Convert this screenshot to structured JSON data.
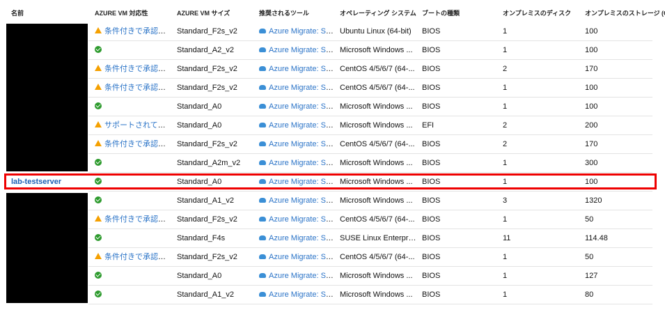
{
  "columns": {
    "name": "名前",
    "compat": "AZURE VM 対応性",
    "size": "AZURE VM サイズ",
    "tool": "推奨されるツール",
    "os": "オペレーティング システム",
    "boot": "ブートの種類",
    "disks": "オンプレミスのディスク",
    "storage": "オンプレミスのストレージ (GB)"
  },
  "colors": {
    "link": "#2a73c7",
    "ok": "#2e9b2e",
    "warning": "#f5a000",
    "highlight": "#ee0000",
    "redaction": "#000000"
  },
  "rows": [
    {
      "name": "",
      "compat_icon": "warning-icon",
      "compat": "条件付きで承認され...",
      "size": "Standard_F2s_v2",
      "tool": "Azure Migrate: Ser...",
      "os": "Ubuntu Linux (64-bit)",
      "boot": "BIOS",
      "disks": "1",
      "storage": "100"
    },
    {
      "name": "",
      "compat_icon": "check-icon",
      "compat": "",
      "size": "Standard_A2_v2",
      "tool": "Azure Migrate: Ser...",
      "os": "Microsoft Windows ...",
      "boot": "BIOS",
      "disks": "1",
      "storage": "100"
    },
    {
      "name": "",
      "compat_icon": "warning-icon",
      "compat": "条件付きで承認され...",
      "size": "Standard_F2s_v2",
      "tool": "Azure Migrate: Ser...",
      "os": "CentOS 4/5/6/7 (64-...",
      "boot": "BIOS",
      "disks": "2",
      "storage": "170"
    },
    {
      "name": "",
      "compat_icon": "warning-icon",
      "compat": "条件付きで承認され...",
      "size": "Standard_F2s_v2",
      "tool": "Azure Migrate: Ser...",
      "os": "CentOS 4/5/6/7 (64-...",
      "boot": "BIOS",
      "disks": "1",
      "storage": "100"
    },
    {
      "name": "",
      "compat_icon": "check-icon",
      "compat": "",
      "size": "Standard_A0",
      "tool": "Azure Migrate: Ser...",
      "os": "Microsoft Windows ...",
      "boot": "BIOS",
      "disks": "1",
      "storage": "100"
    },
    {
      "name": "",
      "compat_icon": "warning-icon",
      "compat": "サポートされていない...",
      "size": "Standard_A0",
      "tool": "Azure Migrate: Ser...",
      "os": "Microsoft Windows ...",
      "boot": "EFI",
      "disks": "2",
      "storage": "200"
    },
    {
      "name": "",
      "compat_icon": "warning-icon",
      "compat": "条件付きで承認され...",
      "size": "Standard_F2s_v2",
      "tool": "Azure Migrate: Ser...",
      "os": "CentOS 4/5/6/7 (64-...",
      "boot": "BIOS",
      "disks": "2",
      "storage": "170"
    },
    {
      "name": "",
      "compat_icon": "check-icon",
      "compat": "",
      "size": "Standard_A2m_v2",
      "tool": "Azure Migrate: Ser...",
      "os": "Microsoft Windows ...",
      "boot": "BIOS",
      "disks": "1",
      "storage": "300"
    },
    {
      "name": "lab-testserver",
      "compat_icon": "check-icon",
      "compat": "",
      "size": "Standard_A0",
      "tool": "Azure Migrate: Ser...",
      "os": "Microsoft Windows ...",
      "boot": "BIOS",
      "disks": "1",
      "storage": "100"
    },
    {
      "name": "",
      "compat_icon": "check-icon",
      "compat": "",
      "size": "Standard_A1_v2",
      "tool": "Azure Migrate: Ser...",
      "os": "Microsoft Windows ...",
      "boot": "BIOS",
      "disks": "3",
      "storage": "1320"
    },
    {
      "name": "",
      "compat_icon": "warning-icon",
      "compat": "条件付きで承認され...",
      "size": "Standard_F2s_v2",
      "tool": "Azure Migrate: Ser...",
      "os": "CentOS 4/5/6/7 (64-...",
      "boot": "BIOS",
      "disks": "1",
      "storage": "50"
    },
    {
      "name": "",
      "compat_icon": "check-icon",
      "compat": "",
      "size": "Standard_F4s",
      "tool": "Azure Migrate: Ser...",
      "os": "SUSE Linux Enterpris...",
      "boot": "BIOS",
      "disks": "11",
      "storage": "114.48"
    },
    {
      "name": "",
      "compat_icon": "warning-icon",
      "compat": "条件付きで承認され...",
      "size": "Standard_F2s_v2",
      "tool": "Azure Migrate: Ser...",
      "os": "CentOS 4/5/6/7 (64-...",
      "boot": "BIOS",
      "disks": "1",
      "storage": "50"
    },
    {
      "name": "",
      "compat_icon": "check-icon",
      "compat": "",
      "size": "Standard_A0",
      "tool": "Azure Migrate: Ser...",
      "os": "Microsoft Windows ...",
      "boot": "BIOS",
      "disks": "1",
      "storage": "127"
    },
    {
      "name": "",
      "compat_icon": "check-icon",
      "compat": "",
      "size": "Standard_A1_v2",
      "tool": "Azure Migrate: Ser...",
      "os": "Microsoft Windows ...",
      "boot": "BIOS",
      "disks": "1",
      "storage": "80"
    }
  ]
}
